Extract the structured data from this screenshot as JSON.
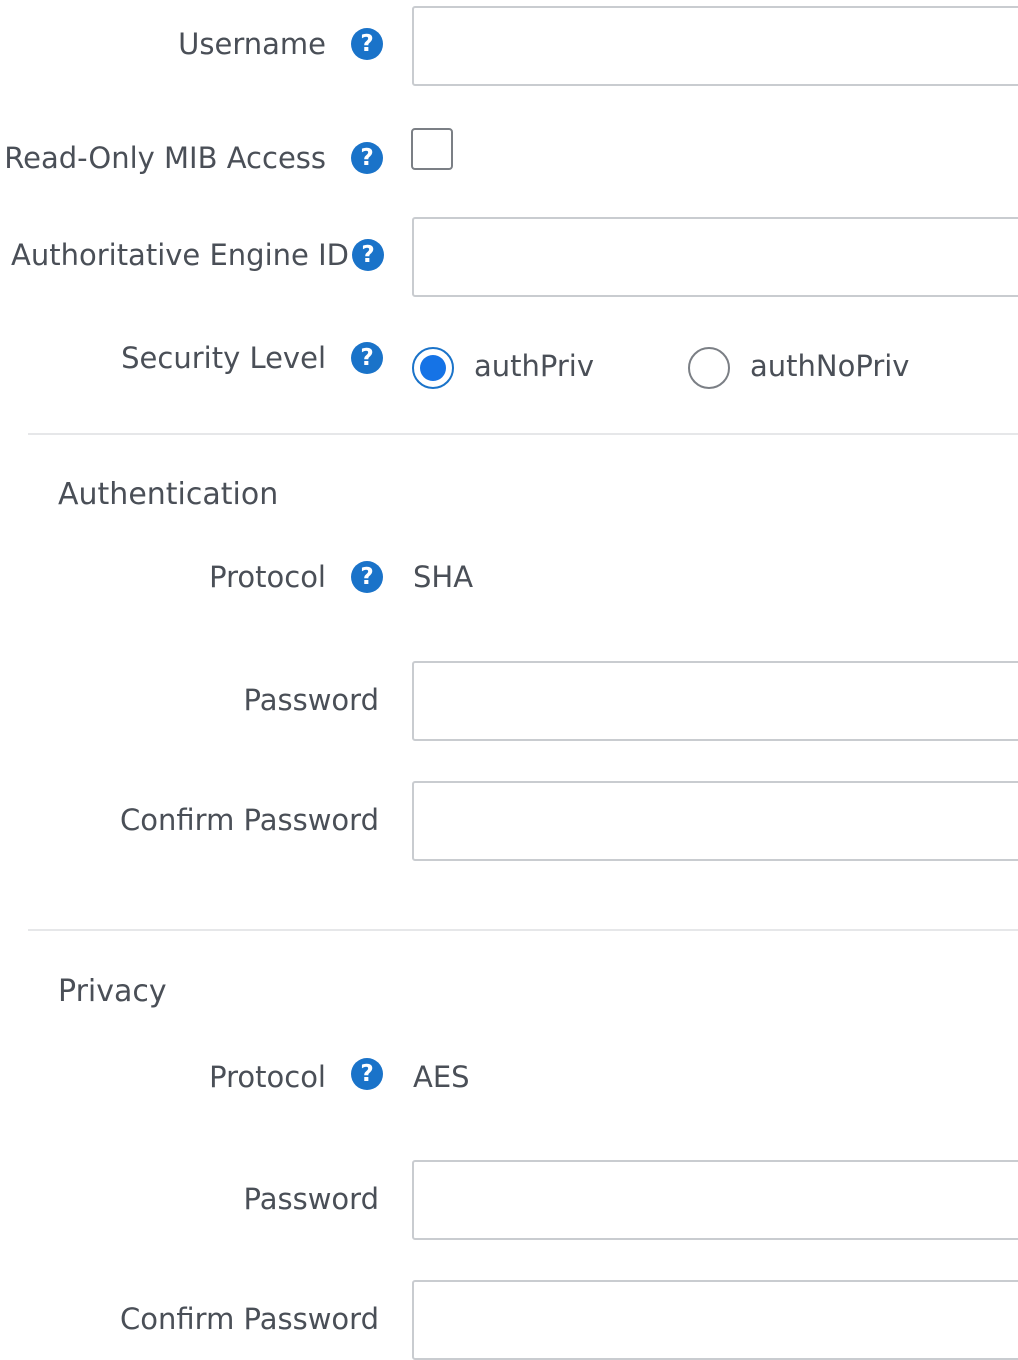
{
  "form": {
    "username": {
      "label": "Username",
      "value": "",
      "help_icon": "question-circle-icon"
    },
    "read_only_mib_access": {
      "label": "Read-Only MIB Access",
      "checked": false,
      "help_icon": "question-circle-icon"
    },
    "authoritative_engine_id": {
      "label": "Authoritative Engine ID",
      "value": "",
      "help_icon": "question-circle-icon"
    },
    "security_level": {
      "label": "Security Level",
      "help_icon": "question-circle-icon",
      "options": [
        {
          "label": "authPriv",
          "selected": true
        },
        {
          "label": "authNoPriv",
          "selected": false
        }
      ]
    }
  },
  "authentication": {
    "title": "Authentication",
    "protocol_label": "Protocol",
    "protocol_value": "SHA",
    "password_label": "Password",
    "confirm_password_label": "Confirm Password"
  },
  "privacy": {
    "title": "Privacy",
    "protocol_label": "Protocol",
    "protocol_value": "AES",
    "password_label": "Password",
    "confirm_password_label": "Confirm Password"
  },
  "help_glyph": "?",
  "colors": {
    "accent": "#1a73c9",
    "radio_fill": "#1573e6",
    "input_border": "#c9ccd0",
    "divider": "#e6e7e9",
    "text": "#4a4f57"
  }
}
